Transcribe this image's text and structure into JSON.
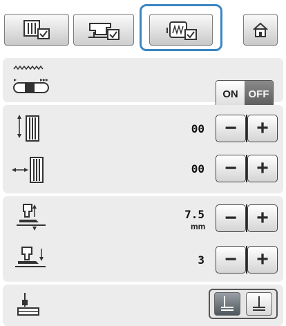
{
  "tabs": [
    {
      "icon": "pattern-settings-icon",
      "selected": false
    },
    {
      "icon": "machine-settings-icon",
      "selected": true
    },
    {
      "icon": "embroidery-settings-icon",
      "selected": false
    }
  ],
  "home_icon": "home-icon",
  "settings": {
    "mirror_toggle": {
      "on_label": "ON",
      "off_label": "OFF",
      "state": "OFF"
    },
    "width_adjust": {
      "value": "00"
    },
    "length_adjust": {
      "value": "00"
    },
    "presser_height": {
      "value": "7.5",
      "unit": "mm"
    },
    "presser_pressure": {
      "value": "3"
    },
    "needle_position": {
      "options": [
        "needle-left-icon",
        "needle-center-icon"
      ],
      "selected": 0
    }
  },
  "colors": {
    "accent": "#3a85c2",
    "panel": "#ececec",
    "selected_tab": "#4d565d"
  }
}
